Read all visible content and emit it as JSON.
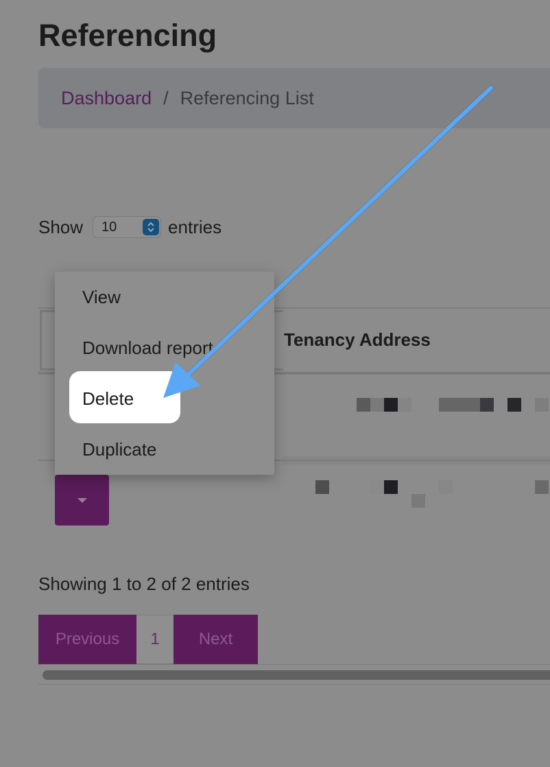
{
  "page": {
    "title": "Referencing"
  },
  "breadcrumb": {
    "home": "Dashboard",
    "separator": "/",
    "current": "Referencing List"
  },
  "length_control": {
    "prefix": "Show",
    "value": "10",
    "suffix": "entries"
  },
  "table": {
    "headers": {
      "address": "Tenancy Address"
    },
    "row_count": 2
  },
  "action_menu": {
    "items": [
      {
        "label": "View"
      },
      {
        "label": "Download report"
      },
      {
        "label": "Delete",
        "highlighted": true
      },
      {
        "label": "Duplicate"
      }
    ]
  },
  "info": {
    "text": "Showing 1 to 2 of 2 entries"
  },
  "pagination": {
    "previous": "Previous",
    "current": "1",
    "next": "Next"
  },
  "colors": {
    "brand": "#5c1c5c",
    "link": "#561e57",
    "overlay": "#8c8c8c",
    "highlight": "#ffffff",
    "annotation_arrow": "#5aa8f5"
  },
  "icons": {
    "select": "chevron-up-down-icon",
    "toggle": "caret-down-icon",
    "annotation": "arrow-icon"
  }
}
